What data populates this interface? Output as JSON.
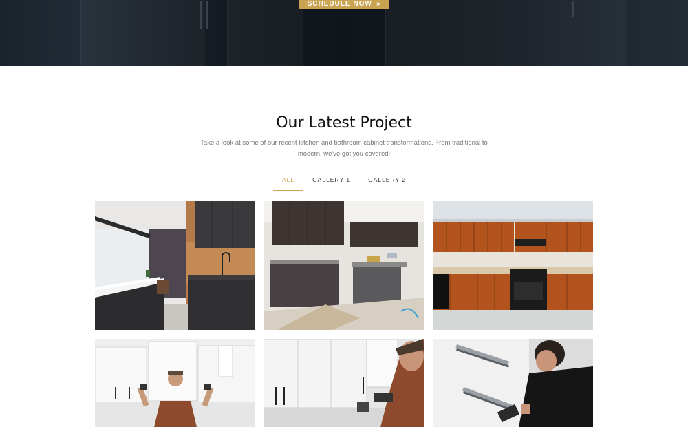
{
  "hero": {
    "button_label": "SCHEDULE NOW",
    "button_icon": "double-chevron-right-icon",
    "accent": "#c9a34f"
  },
  "projects": {
    "title": "Our Latest Project",
    "subtitle": "Take a look at some of our recent kitchen and bathroom cabinet transformations. From traditional to modern, we've got you covered!",
    "tabs": [
      {
        "label": "ALL",
        "active": true
      },
      {
        "label": "GALLERY 1",
        "active": false
      },
      {
        "label": "GALLERY 2",
        "active": false
      }
    ]
  },
  "gallery": {
    "items": [
      {
        "name": "modern-dark-kitchen-photo"
      },
      {
        "name": "kitchen-under-construction-photo"
      },
      {
        "name": "cherry-wood-kitchen-photo"
      },
      {
        "name": "installer-mounting-cabinet-photo"
      },
      {
        "name": "installer-fitting-handle-photo"
      },
      {
        "name": "installer-drawer-slide-photo"
      }
    ]
  }
}
